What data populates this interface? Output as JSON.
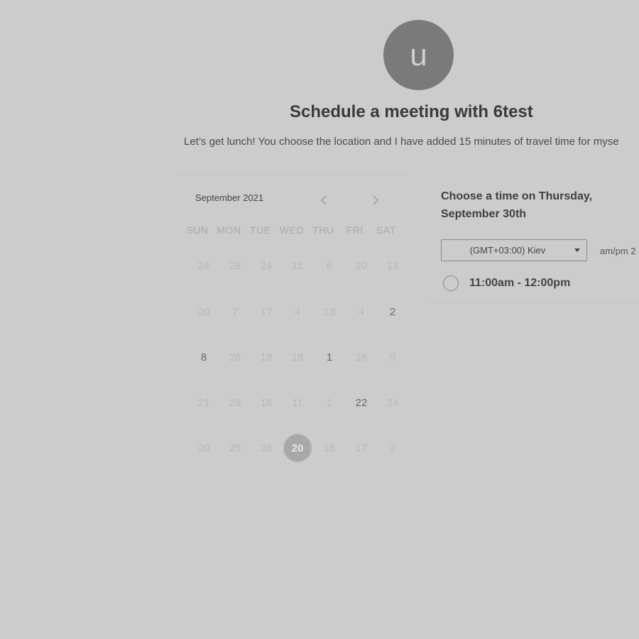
{
  "header": {
    "avatar_initial": "u",
    "title": "Schedule a meeting with 6test",
    "description": "Let’s get lunch! You choose the location and I have added 15 minutes of travel time for myse"
  },
  "calendar": {
    "month_label": "September 2021",
    "prev_icon": "chevron-left-icon",
    "next_icon": "chevron-right-icon",
    "weekdays": [
      "SUN",
      "MON",
      "TUE",
      "WED",
      "THU",
      "FRI",
      "SAT"
    ],
    "weeks": [
      [
        {
          "label": "24",
          "active": false,
          "selected": false
        },
        {
          "label": "28",
          "active": false,
          "selected": false
        },
        {
          "label": "24",
          "active": false,
          "selected": false
        },
        {
          "label": "11",
          "active": false,
          "selected": false
        },
        {
          "label": "6",
          "active": false,
          "selected": false
        },
        {
          "label": "20",
          "active": false,
          "selected": false
        },
        {
          "label": "13",
          "active": false,
          "selected": false
        }
      ],
      [
        {
          "label": "20",
          "active": false,
          "selected": false
        },
        {
          "label": "7",
          "active": false,
          "selected": false
        },
        {
          "label": "17",
          "active": false,
          "selected": false
        },
        {
          "label": "4",
          "active": false,
          "selected": false
        },
        {
          "label": "13",
          "active": false,
          "selected": false
        },
        {
          "label": "4",
          "active": false,
          "selected": false
        },
        {
          "label": "2",
          "active": true,
          "selected": false
        }
      ],
      [
        {
          "label": "8",
          "active": true,
          "selected": false
        },
        {
          "label": "26",
          "active": false,
          "selected": false
        },
        {
          "label": "18",
          "active": false,
          "selected": false
        },
        {
          "label": "18",
          "active": false,
          "selected": false
        },
        {
          "label": "1",
          "active": true,
          "selected": false
        },
        {
          "label": "16",
          "active": false,
          "selected": false
        },
        {
          "label": "5",
          "active": false,
          "selected": false
        }
      ],
      [
        {
          "label": "21",
          "active": false,
          "selected": false
        },
        {
          "label": "29",
          "active": false,
          "selected": false
        },
        {
          "label": "16",
          "active": false,
          "selected": false
        },
        {
          "label": "11",
          "active": false,
          "selected": false
        },
        {
          "label": "1",
          "active": false,
          "selected": false
        },
        {
          "label": "22",
          "active": true,
          "selected": false
        },
        {
          "label": "24",
          "active": false,
          "selected": false
        }
      ],
      [
        {
          "label": "20",
          "active": false,
          "selected": false
        },
        {
          "label": "25",
          "active": false,
          "selected": false
        },
        {
          "label": "26",
          "active": false,
          "selected": false
        },
        {
          "label": "20",
          "active": true,
          "selected": true
        },
        {
          "label": "16",
          "active": false,
          "selected": false
        },
        {
          "label": "17",
          "active": false,
          "selected": false
        },
        {
          "label": "2",
          "active": false,
          "selected": false
        }
      ]
    ]
  },
  "time_panel": {
    "heading": "Choose a time on Thursday, September 30th",
    "timezone_value": "(GMT+03:00) Kiev",
    "timezone_icon": "caret-down-icon",
    "ampm_label": "am/pm  2",
    "slots": [
      {
        "label": "11:00am - 12:00pm",
        "selected": false
      }
    ]
  },
  "colors": {
    "background": "#cccccc",
    "avatar": "#7a7a7a",
    "selected_day": "#a8a8a8",
    "text_dark": "#3a3a3a"
  }
}
